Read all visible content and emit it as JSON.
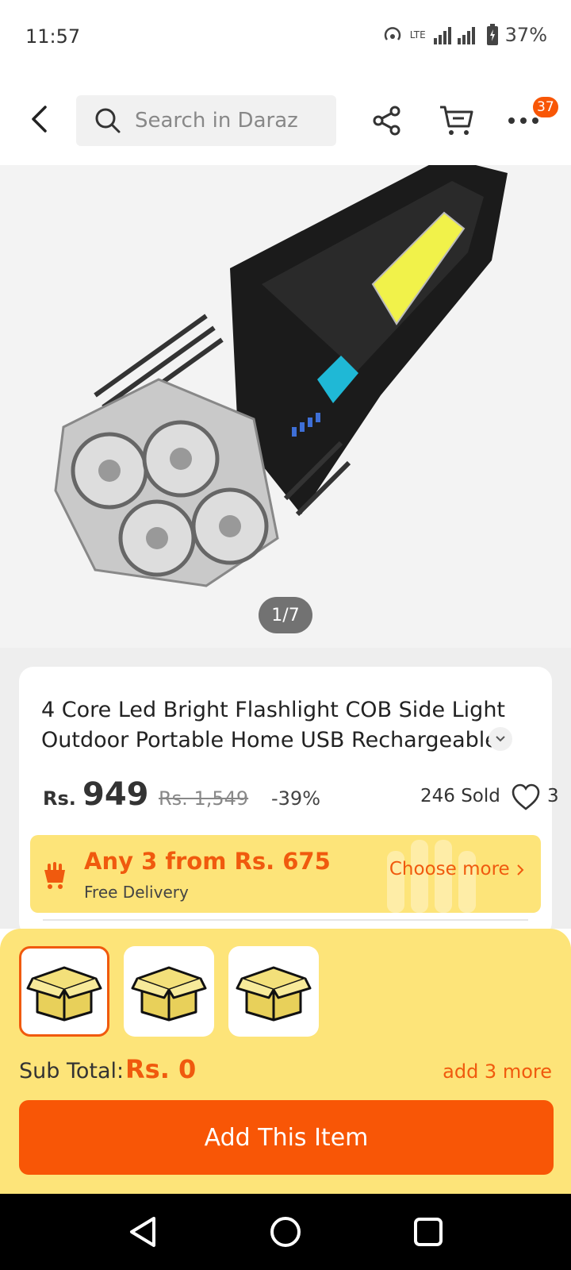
{
  "status": {
    "time": "11:57",
    "network": "LTE",
    "battery": "37%"
  },
  "header": {
    "search_placeholder": "Search in Daraz",
    "cart_badge": "37",
    "icons": [
      "back-arrow-icon",
      "search-icon",
      "share-icon",
      "cart-icon",
      "more-icon"
    ]
  },
  "gallery": {
    "counter": "1/7"
  },
  "product": {
    "title_line1": "4 Core Led Bright Flashlight COB Side Light",
    "title_line2": "Outdoor Portable Home USB Rechargeable",
    "currency": "Rs.",
    "price": "949",
    "old_price": "Rs. 1,549",
    "discount": "-39%",
    "sold": "246 Sold",
    "likes": "3"
  },
  "promo": {
    "title": "Any 3 from Rs. 675",
    "subtitle": "Free Delivery",
    "cta": "Choose more"
  },
  "sheet": {
    "thumbnails": [
      "box-icon",
      "box-icon",
      "box-icon"
    ],
    "subtotal_label": "Sub Total:",
    "subtotal_value": "Rs. 0",
    "add_more": "add 3 more",
    "add_button": "Add This Item"
  },
  "colors": {
    "accent": "#f85606",
    "promo_bg": "#fde479"
  }
}
